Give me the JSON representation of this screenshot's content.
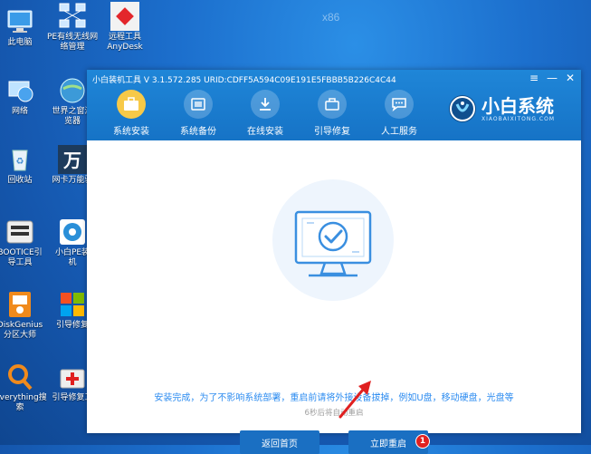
{
  "desktop": {
    "watermark": "x86",
    "icons": [
      {
        "label1": "此电脑",
        "label2": ""
      },
      {
        "label1": "PE有线无线网",
        "label2": "络管理"
      },
      {
        "label1": "远程工具",
        "label2": "AnyDesk"
      },
      {
        "label1": "网络",
        "label2": ""
      },
      {
        "label1": "世界之窗浏",
        "label2": "览器"
      },
      {
        "label1": "回收站",
        "label2": ""
      },
      {
        "label1": "网卡万能驱",
        "label2": ""
      },
      {
        "label1": "BOOTICE引",
        "label2": "导工具"
      },
      {
        "label1": "小白PE装",
        "label2": "机"
      },
      {
        "label1": "DiskGenius",
        "label2": "分区大师"
      },
      {
        "label1": "引导修复",
        "label2": ""
      },
      {
        "label1": "Everything搜",
        "label2": "索"
      },
      {
        "label1": "引导修复工",
        "label2": ""
      }
    ]
  },
  "window": {
    "title": "小白装机工具 V 3.1.572.285 URID:CDFF5A594C09E191E5FBBB5B226C4C44",
    "controls": {
      "menu": "≡",
      "minimize": "—",
      "close": "✕"
    },
    "tabs": [
      {
        "label": "系统安装",
        "icon": "briefcase-icon"
      },
      {
        "label": "系统备份",
        "icon": "backup-icon"
      },
      {
        "label": "在线安装",
        "icon": "download-icon"
      },
      {
        "label": "引导修复",
        "icon": "repair-icon"
      },
      {
        "label": "人工服务",
        "icon": "chat-icon"
      }
    ],
    "brand": {
      "name": "小白系统",
      "subtitle": "XIAOBAIXITONG.COM"
    }
  },
  "content": {
    "message": "安装完成，为了不影响系统部署，重启前请将外接设备拔掉，例如U盘，移动硬盘，光盘等",
    "countdown": "6秒后将自动重启",
    "home_button": "返回首页",
    "restart_button": "立即重启",
    "badge": "1"
  },
  "colors": {
    "accent": "#1a6fc2",
    "title_bar": "#1a7ad0",
    "message": "#2d8cf0",
    "active_tab": "#f7c948"
  }
}
